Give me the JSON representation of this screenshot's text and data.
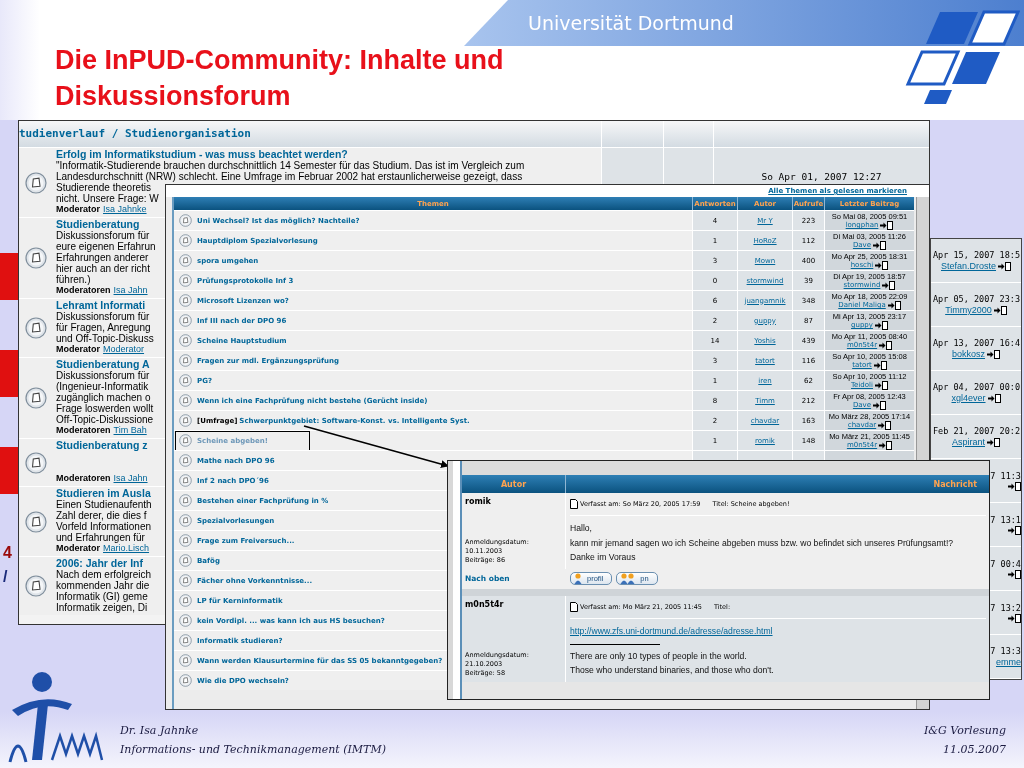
{
  "slide": {
    "university": "Universität Dortmund",
    "title_lines": [
      "Die InPUD-Community: Inhalte und",
      "Diskussionsforum"
    ],
    "side_marks": [
      "4",
      "/"
    ]
  },
  "forum_overview": {
    "category": "tudienverlauf / Studienorganisation",
    "forums": [
      {
        "title": "Erfolg im Informatikstudium - was muss beachtet werden?",
        "lines": [
          "\"Informatik-Studierende brauchen durchschnittlich 14 Semester für das Studium. Das ist im Vergleich zum",
          "Landesdurchschnitt (NRW) schlecht. Eine Umfrage im Februar 2002 hat erstaunlicherweise gezeigt, dass",
          "Studierende theoretis",
          "nicht. Unsere Frage: W"
        ],
        "moderator_label": "Moderator",
        "moderator": "Isa Jahnke",
        "last_post": "So Apr 01, 2007 12:27"
      },
      {
        "title": "Studienberatung",
        "lines": [
          "Diskussionsforum für",
          "eure eigenen Erfahrun",
          "Erfahrungen anderer",
          "hier auch an der richt",
          "führen.)"
        ],
        "moderator_label": "Moderatoren",
        "moderator": "Isa Jahn"
      },
      {
        "title": "Lehramt Informati",
        "lines": [
          "Diskussionsforum für",
          "für Fragen, Anregung",
          "und Off-Topic-Diskuss"
        ],
        "moderator_label": "Moderator",
        "moderator": "Moderator"
      },
      {
        "title": "Studienberatung A",
        "lines": [
          "Diskussionsforum für",
          "(Ingenieur-Informatik",
          "zugänglich machen o",
          "Frage loswerden wollt",
          "Off-Topic-Diskussione"
        ],
        "moderator_label": "Moderatoren",
        "moderator": "Tim Bah"
      },
      {
        "title": "Studienberatung z",
        "moderator_label": "Moderatoren",
        "moderator": "Isa Jahn"
      },
      {
        "title": "Studieren im Ausla",
        "lines": [
          "Einen Studienaufenth",
          "Zahl derer, die dies f",
          "Vorfeld Informationen",
          "und Erfahrungen für"
        ],
        "moderator_label": "Moderator",
        "moderator": "Mario.Lisch"
      },
      {
        "title": "2006: Jahr der Inf",
        "lines": [
          "Nach dem erfolgreich",
          "kommenden Jahr die",
          "Informatik (GI) geme",
          "Informatik zeigen, Di"
        ]
      }
    ]
  },
  "side_panel": {
    "entries": [
      {
        "kind": "full",
        "date": "Apr 15, 2007 18:5",
        "user": "Stefan.Droste"
      },
      {
        "kind": "full",
        "date": "Apr 05, 2007 23:3",
        "user": "Timmy2000"
      },
      {
        "kind": "full",
        "date": "Apr 13, 2007 16:4",
        "user": "bokkosz"
      },
      {
        "kind": "full",
        "date": "Apr 04, 2007 00:0",
        "user": "xgl4ever"
      },
      {
        "kind": "full",
        "date": "Feb 21, 2007 20:2",
        "user": "Aspirant"
      },
      {
        "kind": "partial",
        "date": "7 11:3"
      },
      {
        "kind": "partial",
        "date": "7 13:1"
      },
      {
        "kind": "partial",
        "date": "7 00:4"
      },
      {
        "kind": "partial",
        "date": "7 13:2"
      },
      {
        "kind": "partial",
        "date": "7 13:3",
        "user": "emme"
      }
    ]
  },
  "topic_list": {
    "mark_all_read": "Alle Themen als gelesen markieren",
    "columns": [
      "Themen",
      "Antworten",
      "Autor",
      "Aufrufe",
      "Letzter Beitrag"
    ],
    "topics": [
      {
        "title": "Uni Wechsel? Ist das möglich? Nachteile?",
        "replies": "4",
        "author": "Mr Y",
        "views": "223",
        "last_date": "So Mai 08, 2005 09:51",
        "last_user": "longphan",
        "highlighted": false
      },
      {
        "title": "Hauptdiplom Spezialvorlesung",
        "replies": "1",
        "author": "HoRoZ",
        "views": "112",
        "last_date": "Di Mai 03, 2005 11:26",
        "last_user": "Dave",
        "highlighted": false
      },
      {
        "title": "spora umgehen",
        "replies": "3",
        "author": "Mown",
        "views": "400",
        "last_date": "Mo Apr 25, 2005 18:31",
        "last_user": "hoschi",
        "highlighted": false
      },
      {
        "title": "Prüfungsprotokolle Inf 3",
        "replies": "0",
        "author": "stormwind",
        "views": "39",
        "last_date": "Di Apr 19, 2005 18:57",
        "last_user": "stormwind",
        "highlighted": false
      },
      {
        "title": "Microsoft Lizenzen wo?",
        "replies": "6",
        "author": "juangamnik",
        "views": "348",
        "last_date": "Mo Apr 18, 2005 22:09",
        "last_user": "Daniel Maliga",
        "highlighted": false
      },
      {
        "title": "Inf III nach der DPO 96",
        "replies": "2",
        "author": "guppy",
        "views": "87",
        "last_date": "Mi Apr 13, 2005 23:17",
        "last_user": "guppy",
        "highlighted": false
      },
      {
        "title": "Scheine Hauptstudium",
        "replies": "14",
        "author": "Yoshis",
        "views": "439",
        "last_date": "Mo Apr 11, 2005 08:40",
        "last_user": "m0n5t4r",
        "highlighted": false
      },
      {
        "title": "Fragen zur mdl. Ergänzungsprüfung",
        "replies": "3",
        "author": "tatort",
        "views": "116",
        "last_date": "So Apr 10, 2005 15:08",
        "last_user": "tatort",
        "highlighted": false
      },
      {
        "title": "PG?",
        "replies": "1",
        "author": "iren",
        "views": "62",
        "last_date": "So Apr 10, 2005 11:12",
        "last_user": "Teidoli",
        "highlighted": false
      },
      {
        "title": "Wenn ich eine Fachprüfung nicht bestehe (Gerücht inside)",
        "replies": "8",
        "author": "Timm",
        "views": "212",
        "last_date": "Fr Apr 08, 2005 12:43",
        "last_user": "Dave",
        "highlighted": false
      },
      {
        "prefix": "[Umfrage]",
        "title": "Schwerpunktgebiet: Software-Konst. vs. Intelligente Syst.",
        "replies": "2",
        "author": "chavdar",
        "views": "163",
        "last_date": "Mo März 28, 2005 17:14",
        "last_user": "chavdar",
        "highlighted": false
      },
      {
        "title": "Scheine abgeben!",
        "replies": "1",
        "author": "romik",
        "views": "148",
        "last_date": "Mo März 21, 2005 11:45",
        "last_user": "m0n5t4r",
        "highlighted": true
      },
      {
        "title": "Mathe nach DPO 96",
        "highlighted": false
      },
      {
        "title": "Inf 2 nach DPO´96",
        "highlighted": false
      },
      {
        "title": "Bestehen einer Fachprüfung in %",
        "highlighted": false
      },
      {
        "title": "Spezialvorlesungen",
        "highlighted": false
      },
      {
        "title": "Frage zum Freiversuch...",
        "highlighted": false
      },
      {
        "title": "Bafög",
        "highlighted": false
      },
      {
        "title": "Fächer ohne Vorkenntnisse...",
        "highlighted": false
      },
      {
        "title": "LP für Kerninformatik",
        "highlighted": false
      },
      {
        "title": "kein Vordipl. ... was kann ich aus HS besuchen?",
        "highlighted": false
      },
      {
        "title": "Informatik studieren?",
        "highlighted": false
      },
      {
        "title": "Wann werden Klausurtermine für das SS 05 bekanntgegeben?",
        "highlighted": false
      },
      {
        "title": "Wie die DPO wechseln?",
        "highlighted": false
      }
    ]
  },
  "thread": {
    "columns": [
      "Autor",
      "Nachricht"
    ],
    "posts": [
      {
        "author": "romik",
        "posted": "Verfasst am: So März 20, 2005 17:59",
        "title_label": "Titel: Scheine abgeben!",
        "body": [
          "Hallo,",
          "kann mir jemand sagen wo ich Scheine abgeben muss bzw. wo befindet sich unseres Prüfungsamt!?",
          "Danke im Voraus"
        ],
        "joined_label": "Anmeldungsdatum:",
        "joined": "10.11.2003",
        "post_count": "Beiträge: 86",
        "back_to_top": "Nach oben",
        "buttons": [
          "profil",
          "pn"
        ]
      },
      {
        "author": "m0n5t4r",
        "posted": "Verfasst am: Mo März 21, 2005 11:45",
        "title_label": "Titel:",
        "link": "http://www.zfs.uni-dortmund.de/adresse/adresse.html",
        "body": [
          "There are only 10 types of people in the world.",
          "Those who understand binaries, and those who don't."
        ],
        "joined_label": "Anmeldungsdatum:",
        "joined": "21.10.2003",
        "post_count": "Beiträge: 58"
      }
    ]
  },
  "footer": {
    "author": "Dr. Isa Jahnke",
    "institute": "Informations- und Technikmanagement (IMTM)",
    "course": "I&G Vorlesung",
    "date": "11.05.2007"
  }
}
